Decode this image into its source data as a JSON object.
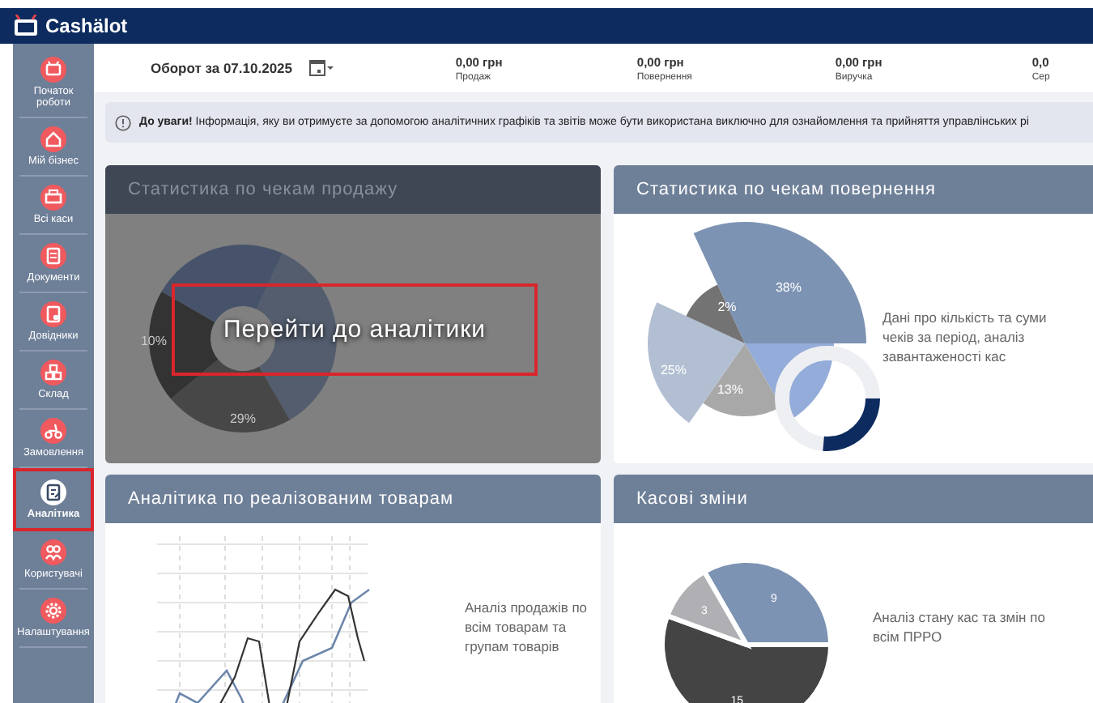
{
  "header": {
    "logo": "Cashälot"
  },
  "sidebar": {
    "items": [
      {
        "label": "Початок роботи",
        "selected": false
      },
      {
        "label": "Мій бізнес",
        "selected": false
      },
      {
        "label": "Всі каси",
        "selected": false
      },
      {
        "label": "Документи",
        "selected": false
      },
      {
        "label": "Довідники",
        "selected": false
      },
      {
        "label": "Склад",
        "selected": false
      },
      {
        "label": "Замовлення",
        "selected": false
      },
      {
        "label": "Аналітика",
        "selected": true
      },
      {
        "label": "Користувачі",
        "selected": false
      },
      {
        "label": "Налаштування",
        "selected": false
      }
    ]
  },
  "turnover": {
    "label": "Оборот за 07.10.2025"
  },
  "stats": [
    {
      "value": "0,00 грн",
      "label": "Продаж"
    },
    {
      "value": "0,00 грн",
      "label": "Повернення"
    },
    {
      "value": "0,00 грн",
      "label": "Виручка"
    },
    {
      "value": "0,0",
      "label": "Сер"
    }
  ],
  "notice": {
    "text": "**До уваги!** Інформація, яку ви отримуєте за допомогою аналітичних графіків та звітів може бути використана виключно для ознайомлення та прийняття управлінських рі"
  },
  "cards": [
    {
      "kind": "donut",
      "title": "Статистика по чекам продажу",
      "labels": [
        "10%",
        "29%"
      ],
      "overlay_button": "Перейти до аналітики"
    },
    {
      "kind": "polar",
      "title": "Статистика по чекам повернення",
      "description": "Дані про кількість та суми чеків за період, аналіз завантаженості кас",
      "labels": [
        "38%",
        "2%",
        "25%",
        "13%"
      ]
    },
    {
      "kind": "line",
      "title": "Аналітика по реалізованим товарам",
      "description": "Аналіз продажів по всім товарам та групам товарів"
    },
    {
      "kind": "pie",
      "title": "Касові зміни",
      "description": "Аналіз стану кас та змін по всім ПРРО",
      "chart_data": {
        "type": "pie",
        "values": [
          9,
          15,
          3
        ],
        "data_labels": true
      }
    }
  ]
}
